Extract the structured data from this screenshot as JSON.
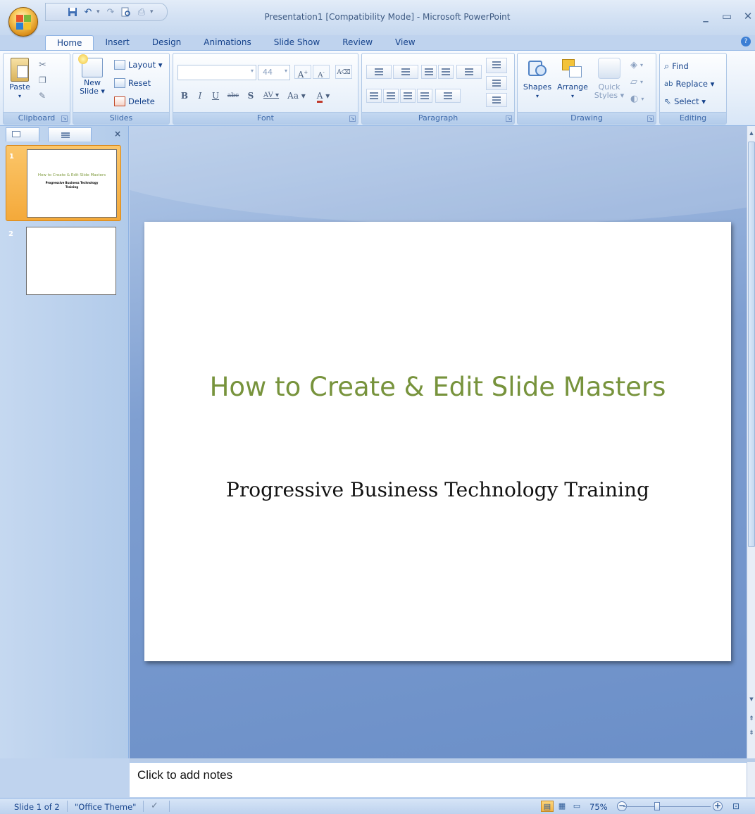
{
  "window": {
    "title": "Presentation1 [Compatibility Mode] - Microsoft PowerPoint",
    "controls": {
      "minimize": "_",
      "maximize": "▭",
      "close": "✕"
    }
  },
  "quick_access": {
    "save_icon": "save-icon",
    "undo_icon": "undo-icon",
    "redo_icon": "redo-icon",
    "print_preview_icon": "print-preview-icon",
    "customize_icon": "customize-icon"
  },
  "tabs": [
    "Home",
    "Insert",
    "Design",
    "Animations",
    "Slide Show",
    "Review",
    "View"
  ],
  "active_tab": "Home",
  "ribbon": {
    "clipboard": {
      "label": "Clipboard",
      "paste": "Paste",
      "cut_icon": "cut-icon",
      "copy_icon": "copy-icon",
      "format_painter_icon": "format-painter-icon"
    },
    "slides": {
      "label": "Slides",
      "new_slide_line1": "New",
      "new_slide_line2": "Slide ▾",
      "layout": "Layout ▾",
      "reset": "Reset",
      "delete": "Delete"
    },
    "font": {
      "label": "Font",
      "font_name": "",
      "font_size": "44",
      "bold": "B",
      "italic": "I",
      "underline": "U",
      "strikethrough": "abc",
      "shadow": "S",
      "spacing": "AV",
      "change_case": "Aa",
      "color": "A",
      "grow": "A",
      "shrink": "A"
    },
    "paragraph": {
      "label": "Paragraph"
    },
    "drawing": {
      "label": "Drawing",
      "shapes": "Shapes",
      "arrange": "Arrange",
      "quick_styles_line1": "Quick",
      "quick_styles_line2": "Styles"
    },
    "editing": {
      "label": "Editing",
      "find": "Find",
      "replace": "Replace ▾",
      "select": "Select ▾"
    }
  },
  "slides_pane": {
    "thumbnails": [
      {
        "number": "1",
        "title": "How to Create & Edit Slide Masters",
        "subtitle": "Progressive Business Technology Training",
        "selected": true
      },
      {
        "number": "2",
        "title": "",
        "subtitle": "",
        "selected": false
      }
    ]
  },
  "slide": {
    "title": "How to Create & Edit Slide Masters",
    "subtitle": "Progressive Business Technology Training",
    "title_color": "#77933C"
  },
  "notes": {
    "placeholder": "Click to add notes"
  },
  "status_bar": {
    "slide_info": "Slide 1 of 2",
    "theme": "\"Office Theme\"",
    "zoom": "75%",
    "zoom_level": 0.75
  },
  "colors": {
    "ribbon_text": "#15428B",
    "selected_thumb": "#F4A93A"
  }
}
